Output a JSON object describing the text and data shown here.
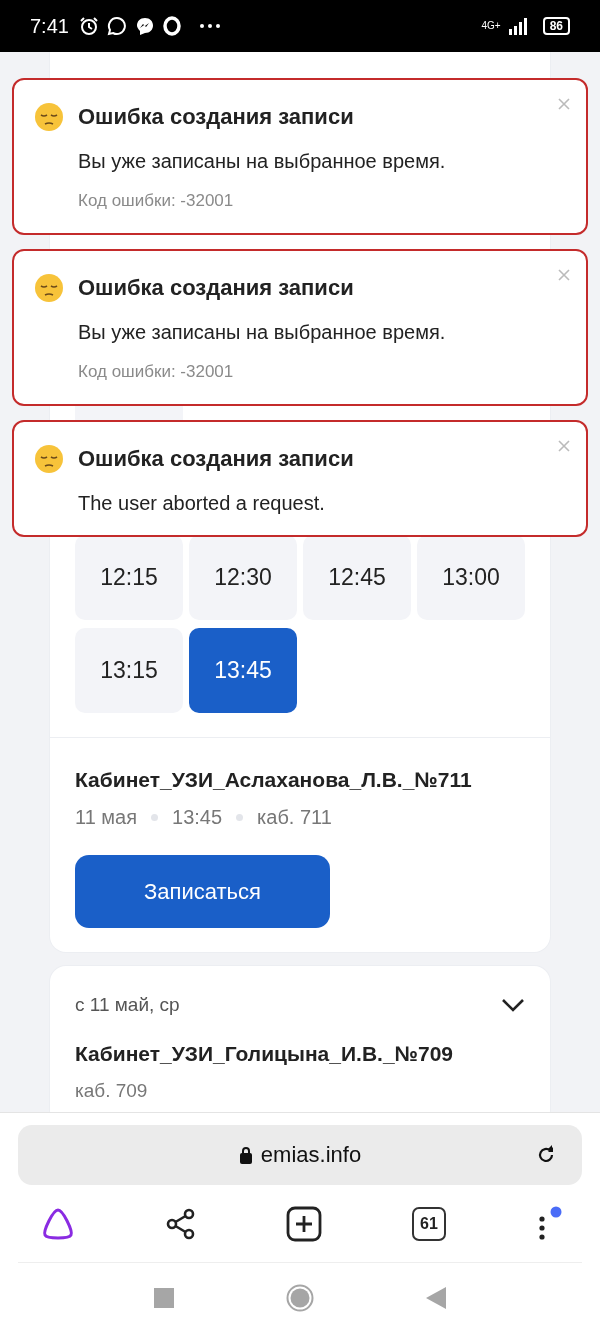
{
  "status_bar": {
    "time": "7:41",
    "network": "4G+",
    "battery": "86"
  },
  "toasts": [
    {
      "title": "Ошибка создания записи",
      "message": "Вы уже записаны на выбранное время.",
      "code": "Код ошибки: -32001"
    },
    {
      "title": "Ошибка создания записи",
      "message": "Вы уже записаны на выбранное время.",
      "code": "Код ошибки: -32001"
    },
    {
      "title": "Ошибка создания записи",
      "message": "The user aborted a request."
    }
  ],
  "hidden_slot": {
    "kind": "slot"
  },
  "slots": [
    {
      "time": "12:15",
      "selected": false
    },
    {
      "time": "12:30",
      "selected": false
    },
    {
      "time": "12:45",
      "selected": false
    },
    {
      "time": "13:00",
      "selected": false
    },
    {
      "time": "13:15",
      "selected": false
    },
    {
      "time": "13:45",
      "selected": true
    }
  ],
  "selected_slot_info": {
    "room_name": "Кабинет_УЗИ_Аслаханова_Л.В._№711",
    "date": "11 мая",
    "time": "13:45",
    "room": "каб. 711"
  },
  "book_button": "Записаться",
  "next_card": {
    "date": "с 11 май, ср",
    "expanded": false,
    "room_name": "Кабинет_УЗИ_Голицына_И.В._№709",
    "room": "каб. 709"
  },
  "browser": {
    "url": "emias.info",
    "tabs_count": "61",
    "menu_badge": true
  }
}
